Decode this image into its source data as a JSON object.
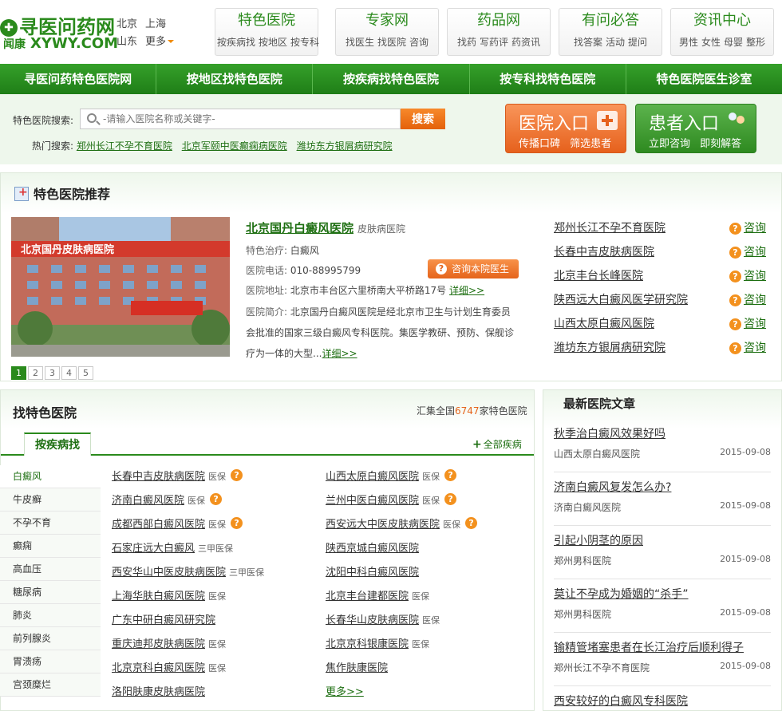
{
  "header": {
    "logo_cn": "寻医问药网",
    "logo_sub_cn": "闻康",
    "logo_en": "XYWY.COM",
    "cities": [
      "北京",
      "上海",
      "山东"
    ],
    "more": "更多",
    "navs": [
      {
        "title": "特色医院",
        "subs": [
          "按疾病找",
          "按地区",
          "按专科"
        ]
      },
      {
        "title": "专家网",
        "subs": [
          "找医生",
          "找医院",
          "咨询"
        ]
      },
      {
        "title": "药品网",
        "subs": [
          "找药",
          "写药评",
          "药资讯"
        ]
      },
      {
        "title": "有问必答",
        "subs": [
          "找答案",
          "活动",
          "提问"
        ]
      },
      {
        "title": "资讯中心",
        "subs": [
          "男性",
          "女性",
          "母婴",
          "整形"
        ]
      }
    ]
  },
  "greenbar": [
    "寻医问药特色医院网",
    "按地区找特色医院",
    "按疾病找特色医院",
    "按专科找特色医院",
    "特色医院医生诊室"
  ],
  "search": {
    "label": "特色医院搜索:",
    "placeholder": "-请输入医院名称或关键字-",
    "button": "搜索",
    "hot_label": "热门搜索:",
    "hot": [
      "郑州长江不孕不育医院",
      "北京军颐中医癫痫病医院",
      "潍坊东方银屑病研究院"
    ]
  },
  "entries": [
    {
      "title": "医院入口",
      "sub": "传播口碑 筛选患者",
      "color": "#e6611c"
    },
    {
      "title": "患者入口",
      "sub": "立即咨询 即刻解答",
      "color": "#2e8a20"
    }
  ],
  "recommend": {
    "title": "特色医院推荐",
    "photo_sign": "北京国丹皮肤病医院",
    "hospital": "北京国丹白癜风医院",
    "type": "皮肤病医院",
    "treat_label": "特色治疗:",
    "treat": "白癜风",
    "phone_label": "医院电话:",
    "phone": "010-88995799",
    "addr_label": "医院地址:",
    "addr": "北京市丰台区六里桥南大平桥路17号",
    "detail": "详细>>",
    "intro_label": "医院简介:",
    "intro": "北京国丹白癜风医院是经北京市卫生与计划生育委员会批准的国家三级白癜风专科医院。集医学教研、预防、保舰诊疗为一体的大型...",
    "ask": "咨询本院医生",
    "pages": [
      "1",
      "2",
      "3",
      "4",
      "5"
    ],
    "list": [
      "郑州长江不孕不育医院",
      "长春中吉皮肤病医院",
      "北京丰台长峰医院",
      "陕西远大白癜风医学研究院",
      "山西太原白癜风医院",
      "潍坊东方银屑病研究院"
    ],
    "consult": "咨询"
  },
  "find": {
    "title": "找特色医院",
    "sum_pre": "汇集全国",
    "sum_num": "6747",
    "sum_post": "家特色医院",
    "tab": "按疾病找",
    "all": "全部疾病",
    "diseases": [
      "白癜风",
      "牛皮癣",
      "不孕不育",
      "癫痫",
      "高血压",
      "糖尿病",
      "肺炎",
      "前列腺炎",
      "胃溃疡",
      "宫颈糜烂"
    ],
    "col1": [
      {
        "name": "长春中吉皮肤病医院",
        "tag": "医保",
        "q": true
      },
      {
        "name": "济南白癜风医院",
        "tag": "医保",
        "q": true
      },
      {
        "name": "成都西部白癜风医院",
        "tag": "医保",
        "q": true
      },
      {
        "name": "石家庄远大白癜风",
        "tag": "三甲医保",
        "q": false
      },
      {
        "name": "西安华山中医皮肤病医院",
        "tag": "三甲医保",
        "q": false
      },
      {
        "name": "上海华肤白癜风医院",
        "tag": "医保",
        "q": false
      },
      {
        "name": "广东中研白癜风研究院",
        "tag": "",
        "q": false
      },
      {
        "name": "重庆迪邦皮肤病医院",
        "tag": "医保",
        "q": false
      },
      {
        "name": "北京京科白癜风医院",
        "tag": "医保",
        "q": false
      },
      {
        "name": "洛阳肤康皮肤病医院",
        "tag": "",
        "q": false
      }
    ],
    "col2": [
      {
        "name": "山西太原白癜风医院",
        "tag": "医保",
        "q": true
      },
      {
        "name": "兰州中医白癜风医院",
        "tag": "医保",
        "q": true
      },
      {
        "name": "西安远大中医皮肤病医院",
        "tag": "医保",
        "q": true
      },
      {
        "name": "陕西京城白癜风医院",
        "tag": "",
        "q": false
      },
      {
        "name": "沈阳中科白癜风医院",
        "tag": "",
        "q": false
      },
      {
        "name": "北京丰台建都医院",
        "tag": "医保",
        "q": false
      },
      {
        "name": "长春华山皮肤病医院",
        "tag": "医保",
        "q": false
      },
      {
        "name": "北京京科银康医院",
        "tag": "医保",
        "q": false
      },
      {
        "name": "焦作肤康医院",
        "tag": "",
        "q": false
      }
    ],
    "more": "更多>>"
  },
  "articles": {
    "title": "最新医院文章",
    "items": [
      {
        "t": "秋季治白癜风效果好吗",
        "h": "山西太原白癜风医院",
        "d": "2015-09-08"
      },
      {
        "t": "济南白癜风复发怎么办?",
        "h": "济南白癜风医院",
        "d": "2015-09-08"
      },
      {
        "t": "引起小阴茎的原因",
        "h": "郑州男科医院",
        "d": "2015-09-08"
      },
      {
        "t": "莫让不孕成为婚姻的“杀手”",
        "h": "郑州男科医院",
        "d": "2015-09-08"
      },
      {
        "t": "输精管堵塞患者在长江治疗后顺利得子",
        "h": "郑州长江不孕不育医院",
        "d": "2015-09-08"
      },
      {
        "t": "西安较好的白癜风专科医院",
        "h": "",
        "d": ""
      }
    ]
  }
}
